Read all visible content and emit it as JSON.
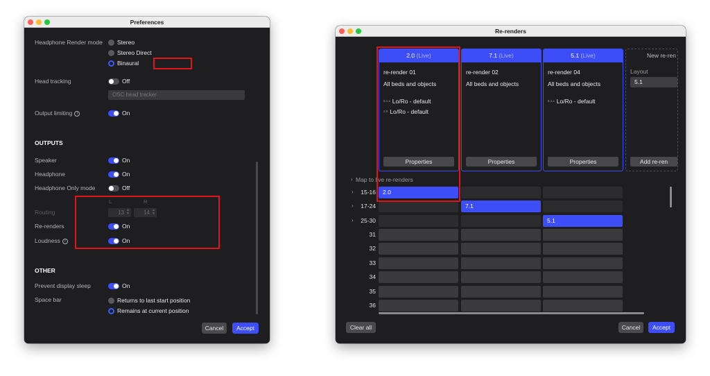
{
  "preferences": {
    "title": "Preferences",
    "headphone_render_mode": {
      "label": "Headphone Render mode",
      "options": [
        "Stereo",
        "Stereo Direct",
        "Binaural"
      ],
      "selected": "Binaural"
    },
    "head_tracking": {
      "label": "Head tracking",
      "toggle": "Off",
      "placeholder": "OSC head tracker"
    },
    "output_limiting": {
      "label": "Output limiting",
      "toggle": "On"
    },
    "outputs": {
      "heading": "OUTPUTS",
      "speaker": {
        "label": "Speaker",
        "toggle": "On"
      },
      "headphone": {
        "label": "Headphone",
        "toggle": "On"
      },
      "headphone_only": {
        "label": "Headphone Only mode",
        "toggle": "Off"
      },
      "routing": {
        "label": "Routing",
        "l_label": "L",
        "r_label": "R",
        "l_value": "13",
        "r_value": "14"
      },
      "rerenders": {
        "label": "Re-renders",
        "toggle": "On"
      },
      "loudness": {
        "label": "Loudness",
        "toggle": "On"
      }
    },
    "other": {
      "heading": "OTHER",
      "prevent_sleep": {
        "label": "Prevent display sleep",
        "toggle": "On"
      },
      "space_bar": {
        "label": "Space bar",
        "options": [
          "Returns to last start position",
          "Remains at current position"
        ],
        "selected": "Remains at current position"
      }
    },
    "cancel": "Cancel",
    "accept": "Accept"
  },
  "rerenders": {
    "title": "Re-renders",
    "cards": [
      {
        "layout": "2.0",
        "live": "(Live)",
        "name": "re-render 01",
        "content": "All beds and objects",
        "downmix": [
          {
            "sup": "5.1.x",
            "text": "Lo/Ro - default"
          },
          {
            "sup": "2.0",
            "text": "Lo/Ro - default"
          }
        ],
        "button": "Properties"
      },
      {
        "layout": "7.1",
        "live": "(Live)",
        "name": "re-render 02",
        "content": "All beds and objects",
        "downmix": [],
        "button": "Properties"
      },
      {
        "layout": "5.1",
        "live": "(Live)",
        "name": "re-render 04",
        "content": "All beds and objects",
        "downmix": [
          {
            "sup": "5.1.x",
            "text": "Lo/Ro - default"
          }
        ],
        "button": "Properties"
      }
    ],
    "new_card": {
      "head": "New re-ren",
      "layout_label": "Layout",
      "layout_value": "5.1",
      "button": "Add re-ren"
    },
    "map_label": "Map to live re-renders",
    "rows": [
      {
        "chev": "›",
        "label": "15-16",
        "cells": [
          "2.0",
          "",
          ""
        ]
      },
      {
        "chev": "›",
        "label": "17-24",
        "cells": [
          "",
          "7.1",
          ""
        ]
      },
      {
        "chev": "›",
        "label": "25-30",
        "cells": [
          "",
          "",
          "5.1"
        ]
      },
      {
        "chev": "",
        "label": "31",
        "cells": [
          "",
          "",
          ""
        ]
      },
      {
        "chev": "",
        "label": "32",
        "cells": [
          "",
          "",
          ""
        ]
      },
      {
        "chev": "",
        "label": "33",
        "cells": [
          "",
          "",
          ""
        ]
      },
      {
        "chev": "",
        "label": "34",
        "cells": [
          "",
          "",
          ""
        ]
      },
      {
        "chev": "",
        "label": "35",
        "cells": [
          "",
          "",
          ""
        ]
      },
      {
        "chev": "",
        "label": "36",
        "cells": [
          "",
          "",
          ""
        ]
      }
    ],
    "clear_all": "Clear all",
    "cancel": "Cancel",
    "accept": "Accept"
  },
  "colors": {
    "accent": "#3d4ef7",
    "annotation": "#e0141b",
    "window_bg": "#1e1e20"
  }
}
